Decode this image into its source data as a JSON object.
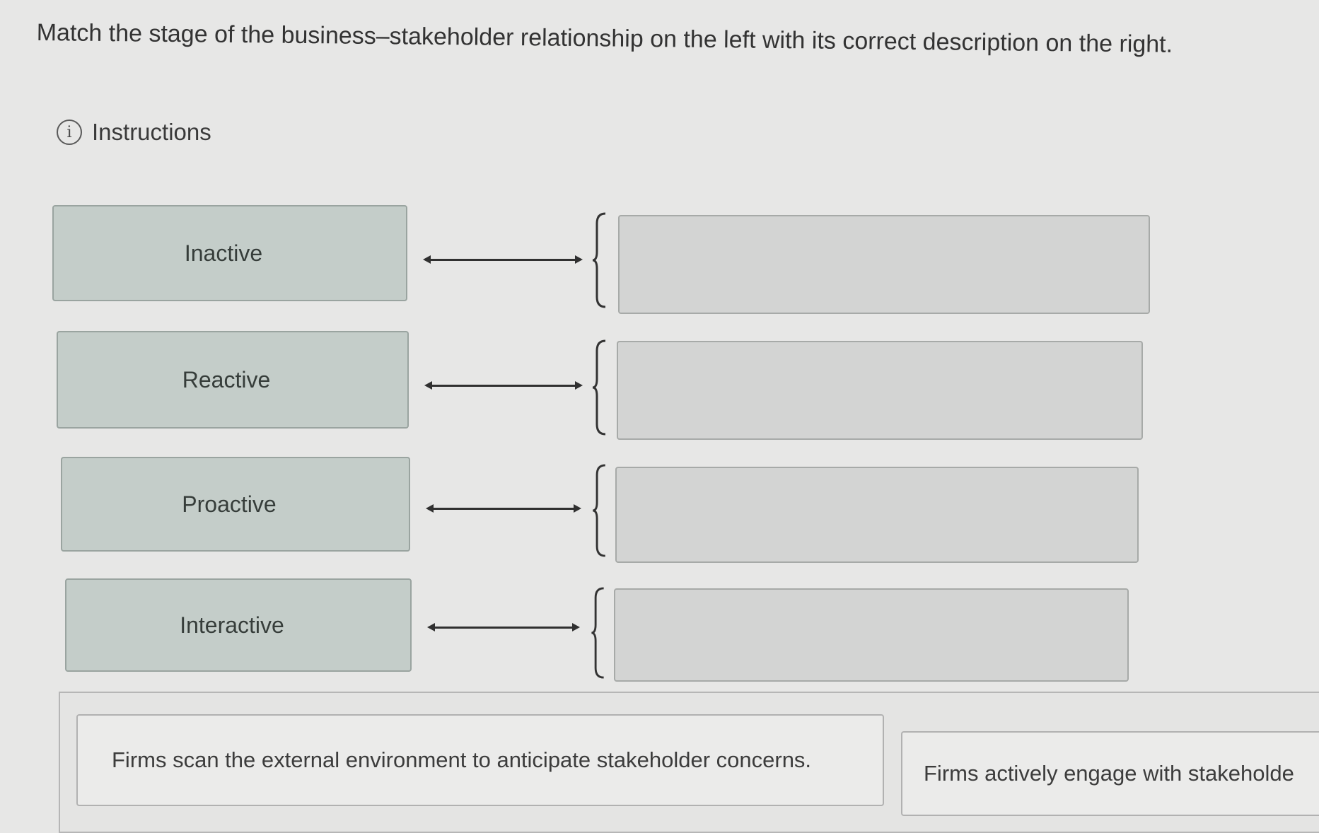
{
  "question": {
    "text": "Match the stage of the business–stakeholder relationship on the left with its correct description on the right."
  },
  "instructions": {
    "icon": "info-icon",
    "icon_glyph": "i",
    "label": "Instructions"
  },
  "stages": [
    {
      "label": "Inactive"
    },
    {
      "label": "Reactive"
    },
    {
      "label": "Proactive"
    },
    {
      "label": "Interactive"
    }
  ],
  "answer_choices": [
    {
      "text": "Firms scan the external environment to anticipate stakeholder concerns."
    },
    {
      "text": "Firms actively engage with stakeholde"
    }
  ],
  "colors": {
    "background": "#e7e7e6",
    "stage_box": "#c4cdc9",
    "drop_zone": "#d3d4d3",
    "answer_card": "#ebebea"
  }
}
